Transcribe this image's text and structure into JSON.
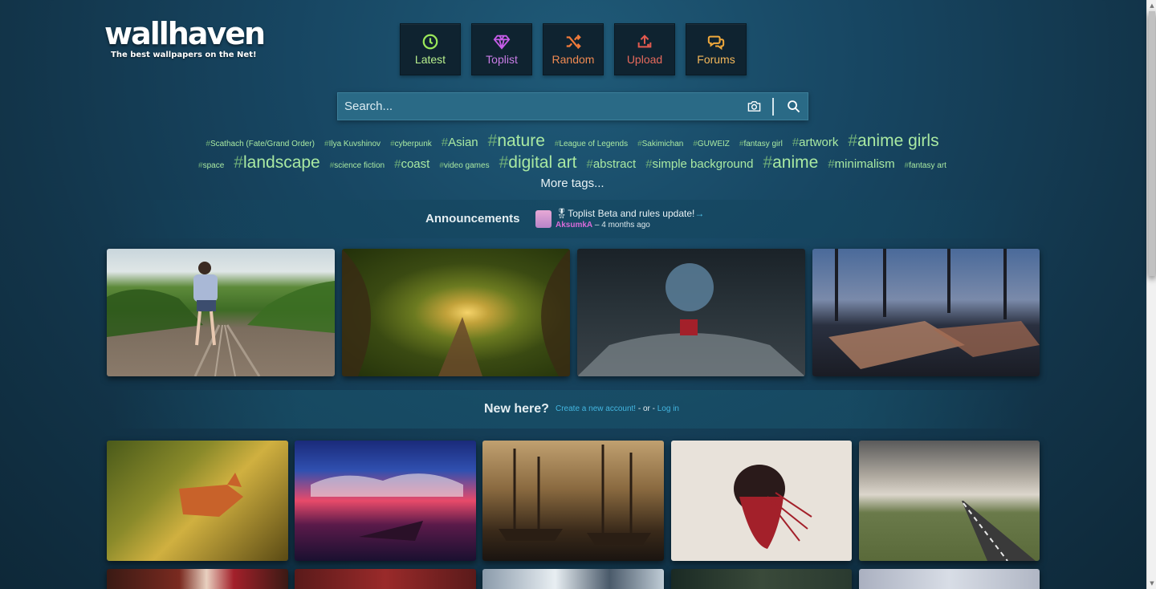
{
  "logo": {
    "name": "wallhaven",
    "tagline": "The best wallpapers on the Net!"
  },
  "nav": [
    {
      "label": "Latest",
      "icon": "clock-icon",
      "color": "#9be85a"
    },
    {
      "label": "Toplist",
      "icon": "diamond-icon",
      "color": "#c65de8"
    },
    {
      "label": "Random",
      "icon": "shuffle-icon",
      "color": "#f07a3a"
    },
    {
      "label": "Upload",
      "icon": "upload-icon",
      "color": "#e35a4f"
    },
    {
      "label": "Forums",
      "icon": "chat-bubbles-icon",
      "color": "#f0a93c"
    }
  ],
  "search": {
    "placeholder": "Search..."
  },
  "tags": {
    "row1": [
      {
        "text": "Scathach (Fate/Grand Order)",
        "size": "s1"
      },
      {
        "text": "Ilya Kuvshinov",
        "size": "s1"
      },
      {
        "text": "cyberpunk",
        "size": "s1"
      },
      {
        "text": "Asian",
        "size": "s2"
      },
      {
        "text": "nature",
        "size": "s3"
      },
      {
        "text": "League of Legends",
        "size": "s1"
      },
      {
        "text": "Sakimichan",
        "size": "s1"
      },
      {
        "text": "GUWEIZ",
        "size": "s1"
      },
      {
        "text": "fantasy girl",
        "size": "s1"
      },
      {
        "text": "artwork",
        "size": "s2"
      },
      {
        "text": "anime girls",
        "size": "s3"
      }
    ],
    "row2": [
      {
        "text": "space",
        "size": "s1"
      },
      {
        "text": "landscape",
        "size": "s3"
      },
      {
        "text": "science fiction",
        "size": "s1"
      },
      {
        "text": "coast",
        "size": "s2"
      },
      {
        "text": "video games",
        "size": "s1"
      },
      {
        "text": "digital art",
        "size": "s3"
      },
      {
        "text": "abstract",
        "size": "s2"
      },
      {
        "text": "simple background",
        "size": "s2"
      },
      {
        "text": "anime",
        "size": "s3"
      },
      {
        "text": "minimalism",
        "size": "s2"
      },
      {
        "text": "fantasy art",
        "size": "s1"
      }
    ],
    "more": "More tags..."
  },
  "announcements": {
    "title": "Announcements",
    "item_title": "🎖Toplist Beta and rules update!",
    "arrow": "→",
    "user": "AksumkA",
    "time": "– 4 months ago"
  },
  "new_here": {
    "question": "New here?",
    "create_link": "Create a new account!",
    "or": "- or -",
    "login_link": "Log in"
  },
  "thumbnails_row1": [
    "girl-on-railway",
    "forest-tunnel-bridge",
    "planet-over-snow-base",
    "anime-classroom-sunset"
  ],
  "thumbnails_row2": [
    "fox-in-forest",
    "boat-pink-clouds",
    "pirate-ships-harbor",
    "abstract-red-head",
    "road-clouds-iceland"
  ],
  "thumbnails_row3": [
    "red-portal",
    "red-smoke",
    "building-snow",
    "dark-castle",
    "misty-mountains"
  ]
}
